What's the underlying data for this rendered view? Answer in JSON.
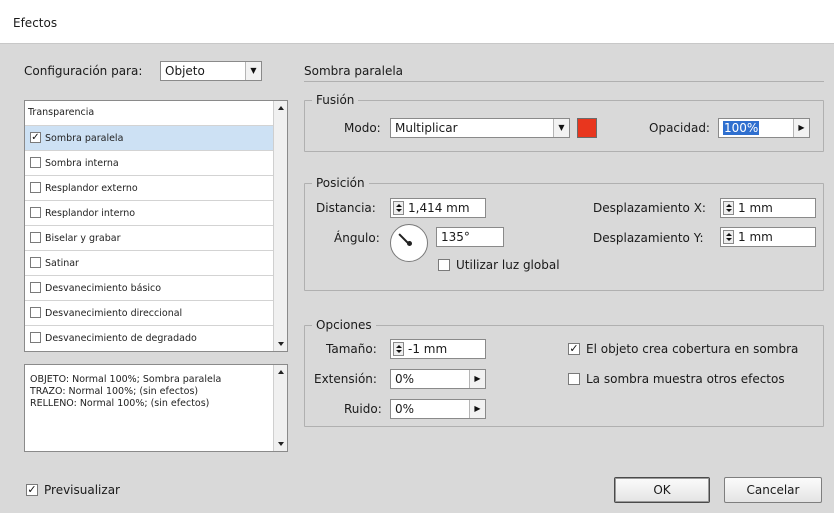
{
  "window": {
    "title": "Efectos"
  },
  "config": {
    "label": "Configuración para:",
    "value": "Objeto"
  },
  "section_title": "Sombra paralela",
  "effects_list": {
    "header": "Transparencia",
    "items": [
      {
        "label": "Sombra paralela",
        "checked": true,
        "selected": true
      },
      {
        "label": "Sombra interna",
        "checked": false
      },
      {
        "label": "Resplandor externo",
        "checked": false
      },
      {
        "label": "Resplandor interno",
        "checked": false
      },
      {
        "label": "Biselar y grabar",
        "checked": false
      },
      {
        "label": "Satinar",
        "checked": false
      },
      {
        "label": "Desvanecimiento básico",
        "checked": false
      },
      {
        "label": "Desvanecimiento direccional",
        "checked": false
      },
      {
        "label": "Desvanecimiento de degradado",
        "checked": false
      }
    ]
  },
  "summary": {
    "lines": [
      "OBJETO: Normal 100%; Sombra paralela",
      "TRAZO: Normal 100%; (sin efectos)",
      "RELLENO: Normal 100%; (sin efectos)"
    ]
  },
  "fusion": {
    "title": "Fusión",
    "mode_label": "Modo:",
    "mode_value": "Multiplicar",
    "color": "#e8361e",
    "opacity_label": "Opacidad:",
    "opacity_value": "100%"
  },
  "position": {
    "title": "Posición",
    "distance_label": "Distancia:",
    "distance_value": "1,414 mm",
    "angle_label": "Ángulo:",
    "angle_value": "135°",
    "global_light_label": "Utilizar luz global",
    "global_light_checked": false,
    "offset_x_label": "Desplazamiento X:",
    "offset_x_value": "1 mm",
    "offset_y_label": "Desplazamiento Y:",
    "offset_y_value": "1 mm"
  },
  "options": {
    "title": "Opciones",
    "size_label": "Tamaño:",
    "size_value": "-1 mm",
    "spread_label": "Extensión:",
    "spread_value": "0%",
    "noise_label": "Ruido:",
    "noise_value": "0%",
    "knockout_label": "El objeto crea cobertura en sombra",
    "knockout_checked": true,
    "honor_other_label": "La sombra muestra otros efectos",
    "honor_other_checked": false
  },
  "preview": {
    "label": "Previsualizar",
    "checked": true
  },
  "buttons": {
    "ok": "OK",
    "cancel": "Cancelar"
  },
  "icons": {
    "checkmark": "✓",
    "dropdown_arrow": "▼",
    "flyout_arrow": "▶"
  }
}
